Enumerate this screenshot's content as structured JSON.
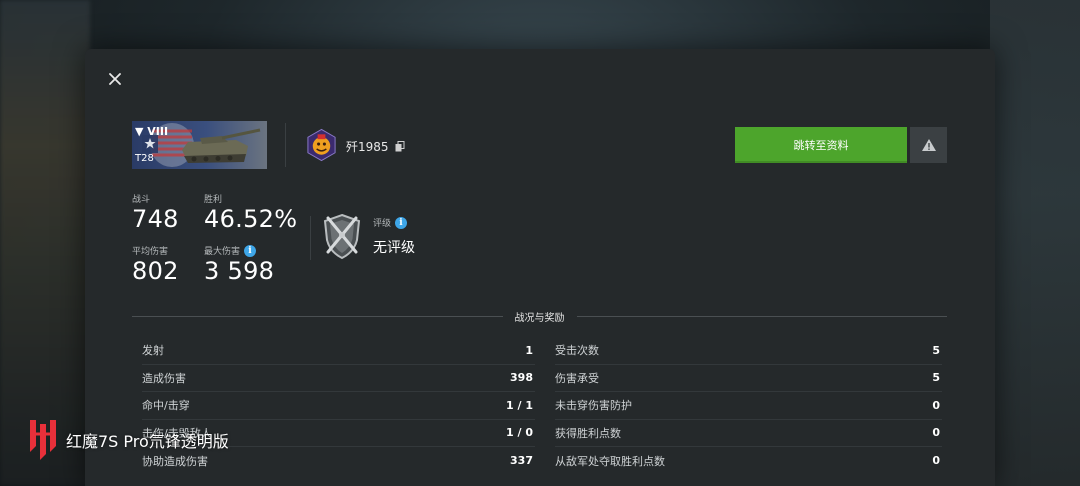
{
  "tank": {
    "tier": "VIII",
    "name": "T28"
  },
  "player": {
    "name": "歼1985"
  },
  "buttons": {
    "goto_profile": "跳转至资料"
  },
  "stats": {
    "battles_label": "战斗",
    "battles_value": "748",
    "wins_label": "胜利",
    "wins_value": "46.52%",
    "avg_damage_label": "平均伤害",
    "avg_damage_value": "802",
    "max_damage_label": "最大伤害",
    "max_damage_value": "3 598"
  },
  "rating": {
    "label": "评级",
    "value": "无评级"
  },
  "section": {
    "title": "战况与奖励"
  },
  "left_rows": [
    {
      "label": "发射",
      "value": "1"
    },
    {
      "label": "造成伤害",
      "value": "398"
    },
    {
      "label": "命中/击穿",
      "value": "1 / 1"
    },
    {
      "label": "击伤/击毁敌人",
      "value": "1 / 0"
    },
    {
      "label": "协助造成伤害",
      "value": "337"
    }
  ],
  "right_rows": [
    {
      "label": "受击次数",
      "value": "5"
    },
    {
      "label": "伤害承受",
      "value": "5"
    },
    {
      "label": "未击穿伤害防护",
      "value": "0"
    },
    {
      "label": "获得胜利点数",
      "value": "0"
    },
    {
      "label": "从敌军处夺取胜利点数",
      "value": "0"
    }
  ],
  "watermark": {
    "text": "红魔7S Pro氘锋透明版"
  },
  "colors": {
    "accent_green": "#4da52c",
    "info_blue": "#3ea6e8",
    "panel_bg": "#25292b"
  },
  "icons": {
    "close": "close-icon",
    "copy": "copy-icon",
    "warning": "warning-icon",
    "info": "info-icon",
    "rating": "shield-swords-icon",
    "avatar": "clan-emblem-icon"
  }
}
